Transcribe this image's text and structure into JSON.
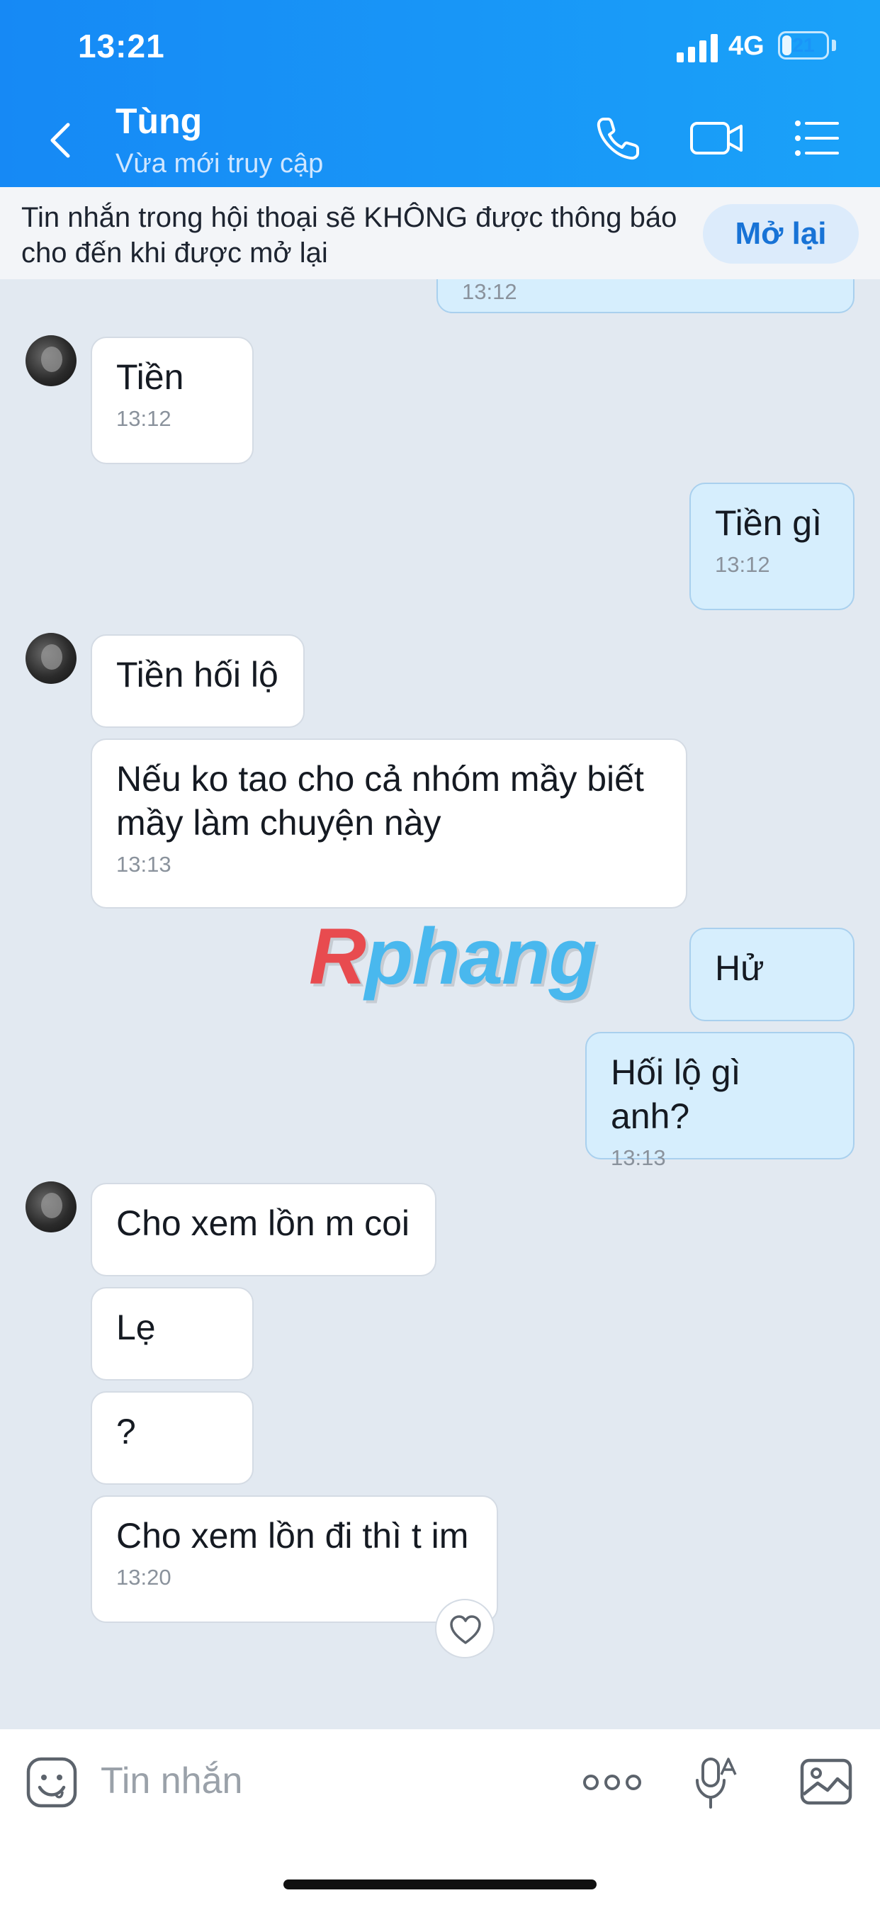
{
  "status_bar": {
    "time": "13:21",
    "network": "4G",
    "battery": "21",
    "battery_level": 0.21
  },
  "header": {
    "name": "Tùng",
    "status": "Vừa mới truy cập"
  },
  "banner": {
    "text": "Tin nhắn trong hội thoại sẽ KHÔNG được thông báo cho đến khi được mở lại",
    "button": "Mở lại"
  },
  "messages": [
    {
      "text": "",
      "time": "13:12"
    },
    {
      "text": "Tiền",
      "time": "13:12"
    },
    {
      "text": "Tiền gì",
      "time": "13:12"
    },
    {
      "text": "Tiền hối lộ",
      "time": ""
    },
    {
      "text": "Nếu ko tao cho cả nhóm mầy biết\nmầy làm chuyện này",
      "time": "13:13"
    },
    {
      "text": "Hử",
      "time": ""
    },
    {
      "text": "Hối lộ gì anh?",
      "time": "13:13"
    },
    {
      "text": "Cho xem lồn m coi",
      "time": ""
    },
    {
      "text": "Lẹ",
      "time": ""
    },
    {
      "text": "?",
      "time": ""
    },
    {
      "text": "Cho xem lồn đi thì t im",
      "time": "13:20"
    }
  ],
  "watermark": {
    "first": "R",
    "rest": "phang"
  },
  "input": {
    "placeholder": "Tin nhắn"
  },
  "icons": {
    "back": "chevron-left-icon",
    "call": "phone-icon",
    "video": "video-camera-icon",
    "menu": "list-menu-icon",
    "sticker": "emoji-icon",
    "more": "more-dots-icon",
    "voice": "microphone-icon",
    "image": "image-icon",
    "reaction": "heart-icon"
  },
  "colors": {
    "header": "#1a95f8",
    "outgoing": "#d6eefd",
    "incoming": "#ffffff",
    "background": "#e2e9f1",
    "accent": "#1873d6"
  }
}
